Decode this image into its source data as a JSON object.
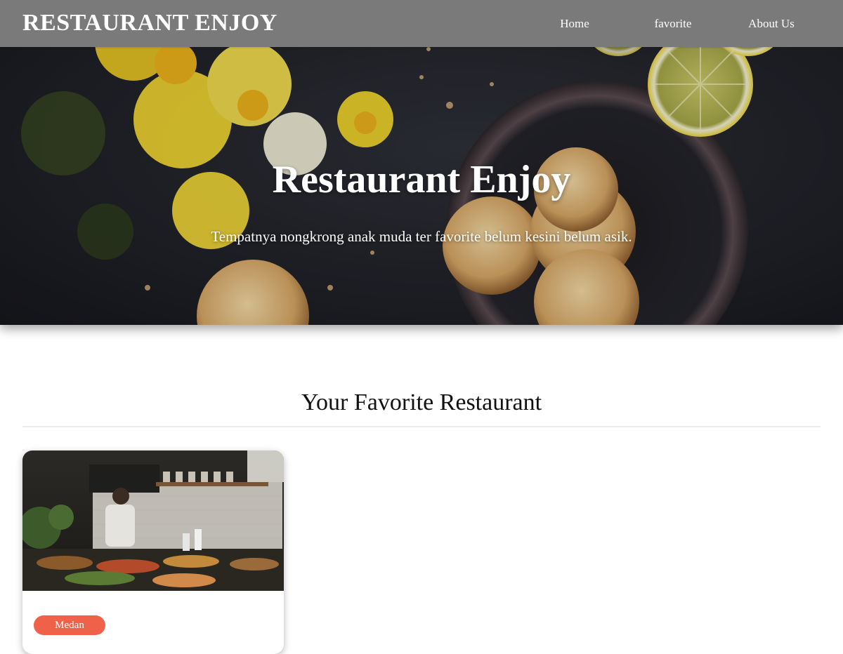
{
  "navbar": {
    "brand": "RESTAURANT ENJOY",
    "links": [
      {
        "label": "Home"
      },
      {
        "label": "favorite"
      },
      {
        "label": "About Us"
      }
    ]
  },
  "hero": {
    "title": "Restaurant Enjoy",
    "tagline": "Tempatnya nongkrong anak muda ter favorite belum kesini belum asik."
  },
  "favorites": {
    "heading": "Your Favorite Restaurant",
    "restaurants": [
      {
        "city": "Medan",
        "image_icon": "restaurant-kitchen-photo"
      }
    ]
  },
  "colors": {
    "navbar_bg": "#7a7a7a",
    "badge_bg": "#f0614a",
    "text_light": "#ffffff"
  }
}
